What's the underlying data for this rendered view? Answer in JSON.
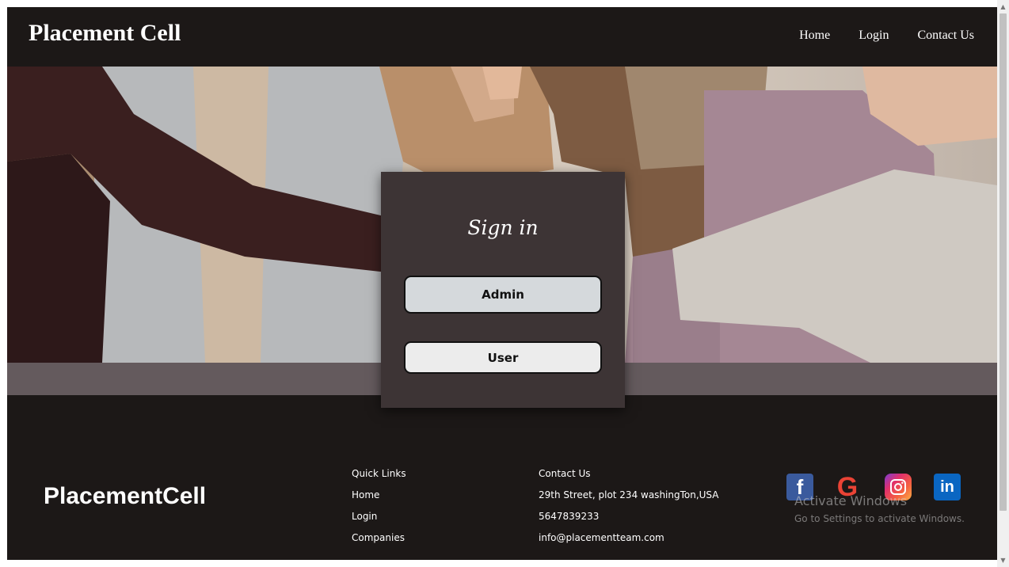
{
  "header": {
    "brand": "Placement Cell",
    "nav": [
      "Home",
      "Login",
      "Contact Us"
    ]
  },
  "signin": {
    "title": "Sign in",
    "admin_label": "Admin",
    "user_label": "User"
  },
  "footer": {
    "logo": "PlacementCell",
    "quick_links": {
      "heading": "Quick Links",
      "items": [
        "Home",
        "Login",
        "Companies"
      ]
    },
    "contact": {
      "heading": "Contact Us",
      "address": "29th Street, plot 234 washingTon,USA",
      "phone": "5647839233",
      "email": "info@placementteam.com"
    },
    "social": {
      "facebook_glyph": "f",
      "google_glyph": "G",
      "linkedin_glyph": "in"
    }
  },
  "watermark": {
    "line1": "Activate Windows",
    "line2": "Go to Settings to activate Windows."
  },
  "icons": [
    "facebook-icon",
    "google-icon",
    "instagram-icon",
    "linkedin-icon"
  ],
  "colors": {
    "background": "#1c1817",
    "card": "#3d3435",
    "band": "#645a5d",
    "admin_button": "#d5d9dc",
    "user_button": "#ececec"
  }
}
